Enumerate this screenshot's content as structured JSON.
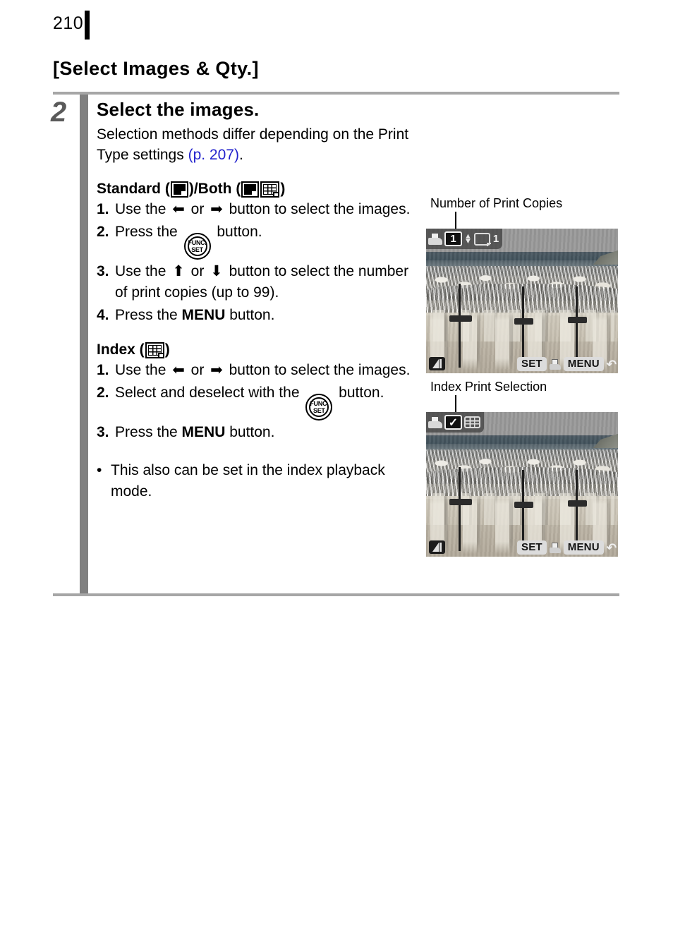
{
  "page": {
    "number": "210",
    "section_title": "[Select Images & Qty.]"
  },
  "step": {
    "number": "2",
    "title": "Select the images.",
    "description_before_link": "Selection methods differ depending on the Print Type settings ",
    "link_text": "(p. 207)",
    "description_after_link": "."
  },
  "standard_section": {
    "heading_prefix": "Standard (",
    "heading_middle": ")/Both (",
    "heading_suffix": ")",
    "icons": [
      "standard-print-icon",
      "standard-print-icon",
      "index-print-icon"
    ],
    "items": [
      {
        "num": "1.",
        "pre": "Use the ",
        "arrow1": "←",
        "mid": " or ",
        "arrow2": "→",
        "post": " button to select the images."
      },
      {
        "num": "2.",
        "pre": "Press the ",
        "icon": "func-set-icon",
        "post": " button."
      },
      {
        "num": "3.",
        "pre": "Use the ",
        "arrow1": "↑",
        "mid": " or ",
        "arrow2": "↓",
        "post": " button to select the number of print copies (up to 99)."
      },
      {
        "num": "4.",
        "pre": "Press the ",
        "strong": "MENU",
        "post": " button."
      }
    ]
  },
  "index_section": {
    "heading_prefix": "Index (",
    "heading_suffix": ")",
    "icon": "index-print-icon",
    "items": [
      {
        "num": "1.",
        "pre": "Use the ",
        "arrow1": "←",
        "mid": " or ",
        "arrow2": "→",
        "post": " button to select the images."
      },
      {
        "num": "2.",
        "pre": "Select and deselect with the ",
        "icon": "func-set-icon",
        "post": " button."
      },
      {
        "num": "3.",
        "pre": "Press the ",
        "strong": "MENU",
        "post": " button."
      }
    ]
  },
  "notes": [
    {
      "bullet": "•",
      "text": "This also can be set in the index playback mode."
    }
  ],
  "screenshots": [
    {
      "callout": "Number of Print Copies",
      "osd": {
        "printer_icon": "printer-icon",
        "copies_value": "1",
        "updown_icon": "up-down-arrows-icon",
        "frame_icon": "single-image-icon",
        "frame_value": "1",
        "quality_icon": "image-quality-icon",
        "set_label": "SET",
        "print_icon": "printer-icon",
        "menu_label": "MENU",
        "return_icon": "return-arrow-icon"
      }
    },
    {
      "callout": "Index Print Selection",
      "osd": {
        "printer_icon": "printer-icon",
        "check_value": "✓",
        "index_icon": "index-print-icon",
        "quality_icon": "image-quality-icon",
        "set_label": "SET",
        "print_icon": "printer-icon",
        "menu_label": "MENU",
        "return_icon": "return-arrow-icon"
      }
    }
  ],
  "colors": {
    "link": "#2222cc",
    "rule": "#a6a6a6",
    "step_bar": "#808080",
    "step_number": "#5a5a5a"
  }
}
